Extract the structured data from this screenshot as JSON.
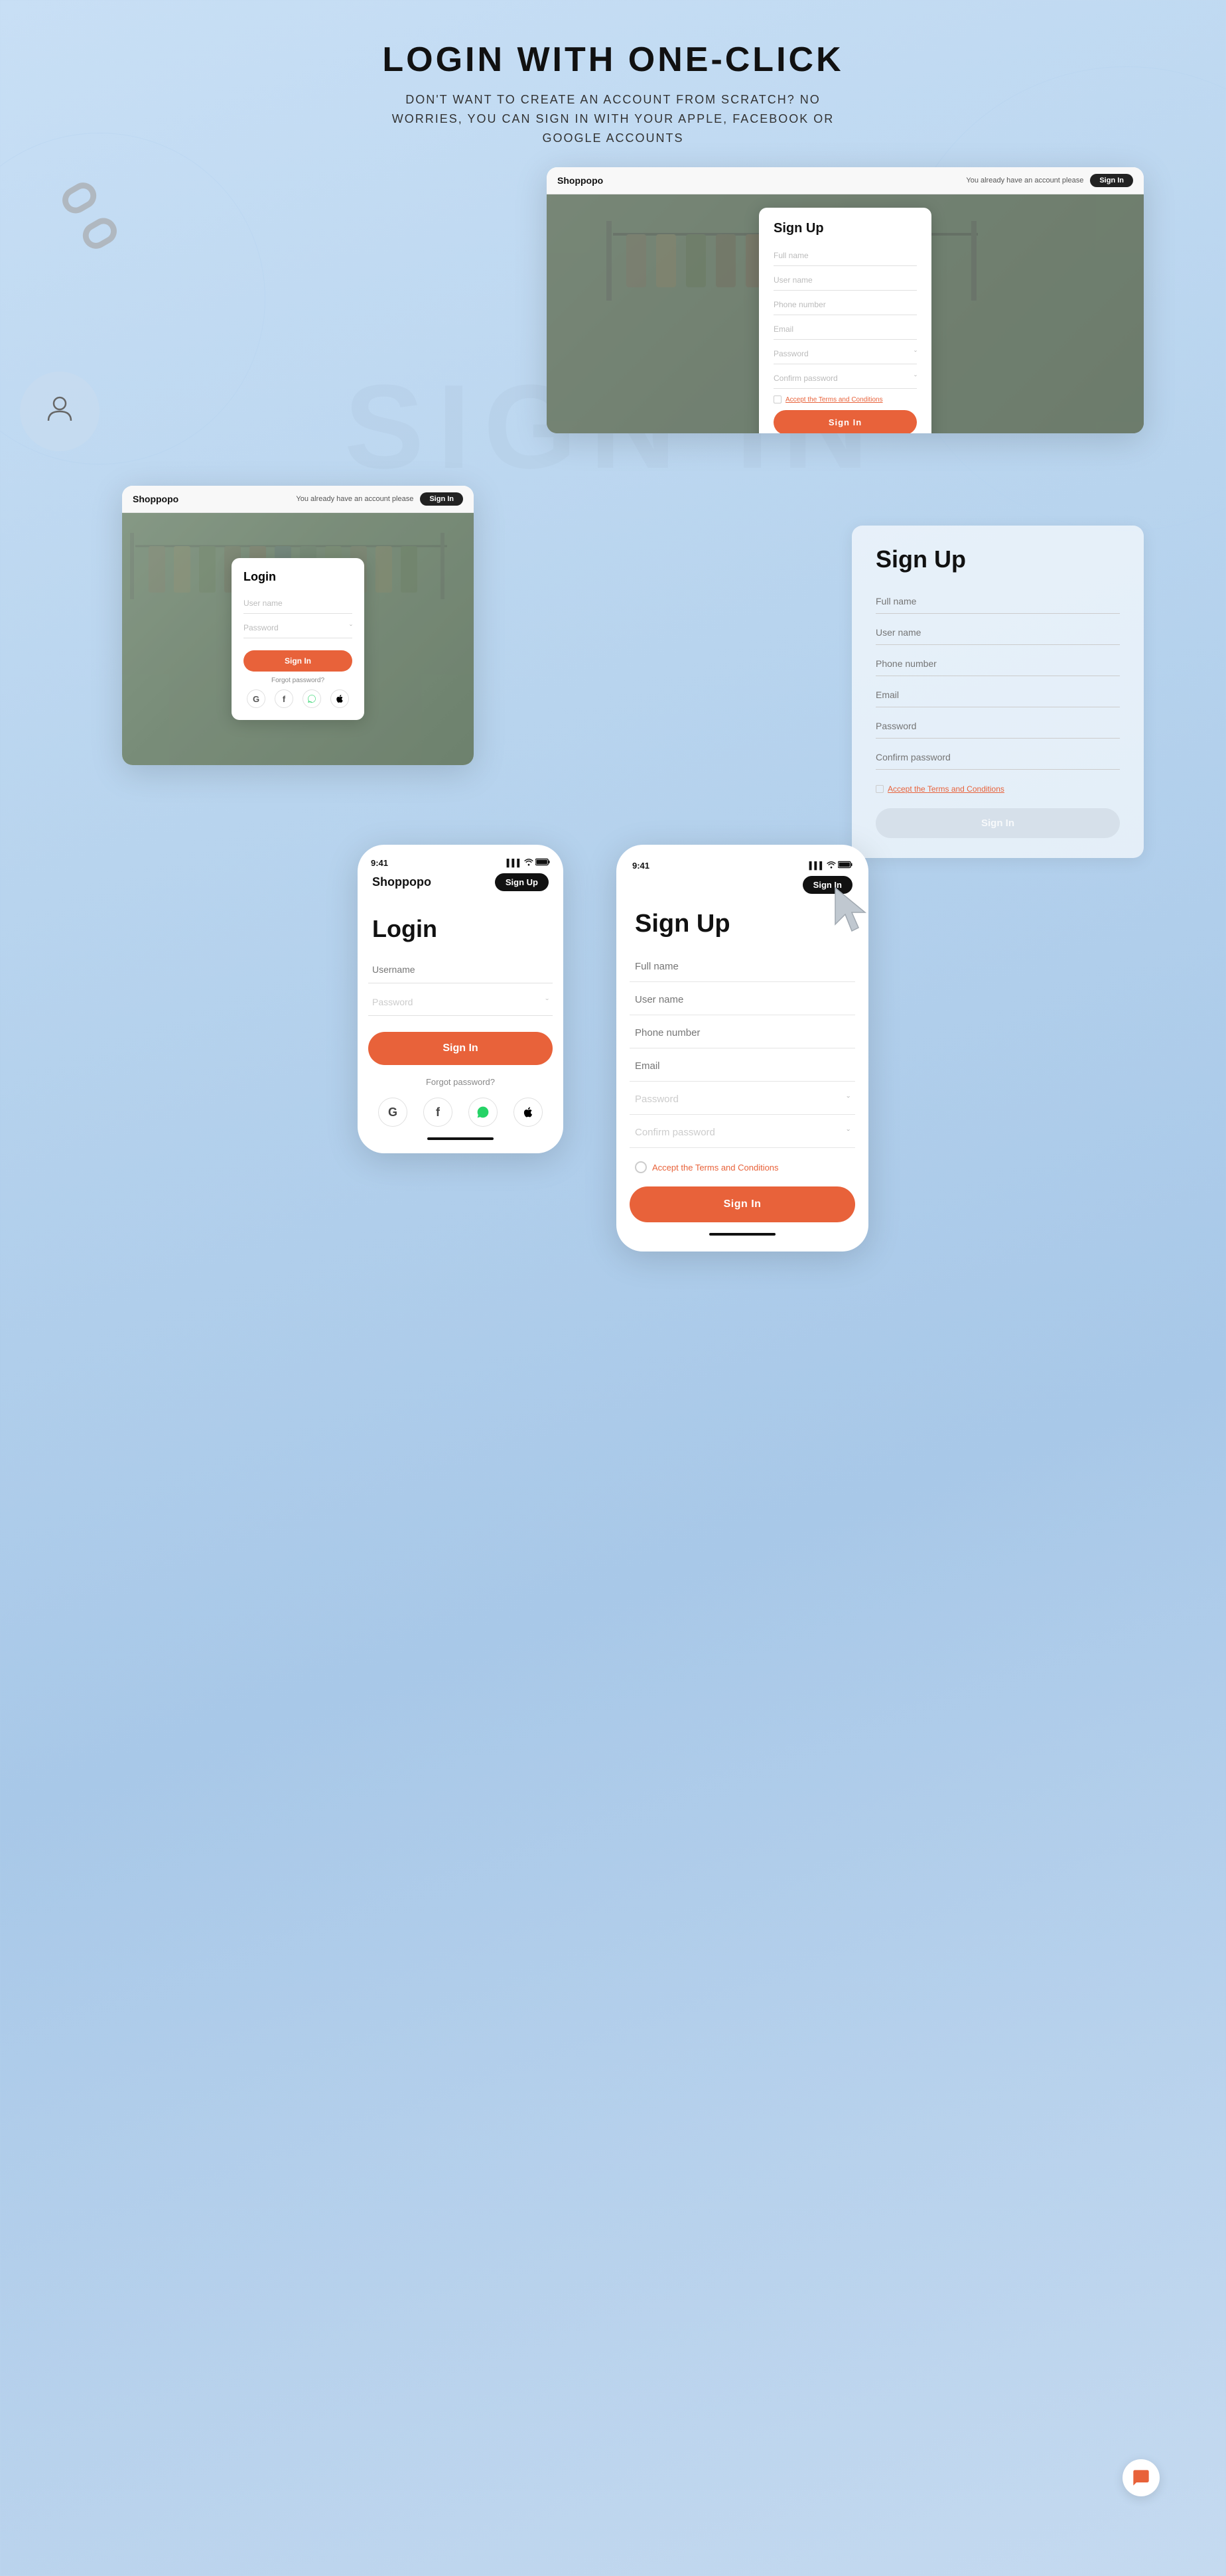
{
  "hero": {
    "title": "LOGIN WITH ONE-CLICK",
    "subtitle": "DON'T WANT TO CREATE AN ACCOUNT FROM SCRATCH? NO WORRIES, YOU CAN SIGN IN WITH YOUR APPLE, FACEBOOK OR GOOGLE ACCOUNTS"
  },
  "desktop_signup": {
    "browser_logo": "Shoppopo",
    "browser_nav_text": "You already have an account please",
    "browser_signin_btn": "Sign In",
    "form_title": "Sign Up",
    "fields": {
      "full_name": "Full name",
      "user_name": "User name",
      "phone_number": "Phone number",
      "email": "Email",
      "password": "Password",
      "confirm_password": "Confirm password"
    },
    "checkbox_text": "Accept the ",
    "checkbox_link": "Terms and Conditions",
    "submit_btn": "Sign In"
  },
  "desktop_login": {
    "browser_logo": "Shoppopo",
    "browser_nav_text": "You already have an account please",
    "browser_signin_btn": "Sign In",
    "form_title": "Login",
    "user_name_placeholder": "User name",
    "password_placeholder": "Password",
    "submit_btn": "Sign In",
    "forgot_password": "Forgot password?",
    "social": [
      "G",
      "f",
      "W",
      ""
    ]
  },
  "partial_signup": {
    "form_title": "Sign Up",
    "fields": {
      "full_name": "Full name",
      "user_name": "User name",
      "phone_number": "Phone number",
      "email": "Email",
      "password": "Password",
      "confirm_password": "Confirm password"
    },
    "checkbox_text": "Accept the ",
    "checkbox_link": "Terms and Conditions",
    "submit_btn": "Sign In"
  },
  "mobile_login": {
    "time": "9:41",
    "logo": "Shoppopo",
    "signup_badge": "Sign Up",
    "title": "Login",
    "username_placeholder": "Username",
    "password_placeholder": "Password",
    "signin_btn": "Sign In",
    "forgot_password": "Forgot password?",
    "social_icons": [
      "G",
      "f",
      "W",
      ""
    ]
  },
  "mobile_signup": {
    "time": "9:41",
    "signin_badge": "Sign In",
    "title": "Sign Up",
    "fields": {
      "full_name": "Full name",
      "user_name": "User name",
      "phone_number": "Phone number",
      "email": "Email",
      "password": "Password",
      "confirm_password": "Confirm password"
    },
    "checkbox_text": "Accept the ",
    "checkbox_link": "Terms and Conditions",
    "submit_btn": "Sign In"
  },
  "colors": {
    "accent": "#e8623a",
    "dark": "#111111",
    "bg_gradient_start": "#c8dff5",
    "bg_gradient_end": "#a8c8e8"
  },
  "watermark": "SIGN IN"
}
